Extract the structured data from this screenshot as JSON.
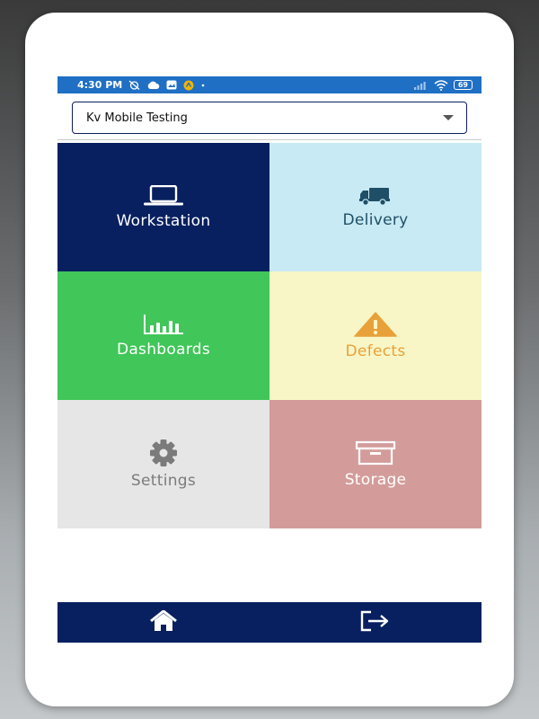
{
  "status_bar": {
    "time": "4:30 PM",
    "battery": "69",
    "icons": [
      "alarm-off-icon",
      "cloud-icon",
      "image-icon",
      "app-icon",
      "dot-icon",
      "signal-icon",
      "wifi-icon",
      "battery-icon"
    ]
  },
  "selector": {
    "value": "Kv Mobile Testing"
  },
  "tiles": [
    {
      "label": "Workstation",
      "icon": "laptop-icon",
      "bg": "#08205f",
      "fg": "#ffffff"
    },
    {
      "label": "Delivery",
      "icon": "truck-icon",
      "bg": "#c8eaf4",
      "fg": "#1f4f66"
    },
    {
      "label": "Dashboards",
      "icon": "bar-chart-icon",
      "bg": "#40c659",
      "fg": "#ffffff"
    },
    {
      "label": "Defects",
      "icon": "warning-icon",
      "bg": "#f8f6c6",
      "fg": "#e8a13a"
    },
    {
      "label": "Settings",
      "icon": "gear-icon",
      "bg": "#e6e6e6",
      "fg": "#7b7b7b"
    },
    {
      "label": "Storage",
      "icon": "archive-box-icon",
      "bg": "#d39c9a",
      "fg": "#ffffff"
    }
  ],
  "bottom_nav": {
    "items": [
      {
        "icon": "home-icon"
      },
      {
        "icon": "logout-icon"
      }
    ],
    "bg": "#08205f"
  }
}
